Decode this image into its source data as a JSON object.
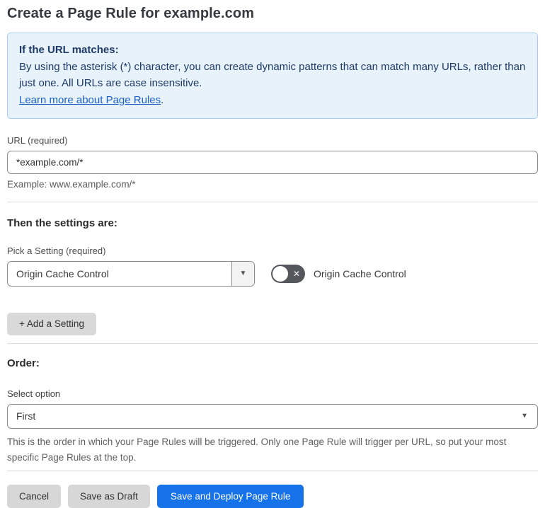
{
  "page": {
    "title": "Create a Page Rule for example.com"
  },
  "info_box": {
    "heading": "If the URL matches:",
    "body": "By using the asterisk (*) character, you can create dynamic patterns that can match many URLs, rather than just one. All URLs are case insensitive.",
    "link_label": "Learn more about Page Rules",
    "link_suffix": "."
  },
  "url_section": {
    "label": "URL (required)",
    "value": "*example.com/*",
    "helper": "Example: www.example.com/*"
  },
  "settings_section": {
    "heading": "Then the settings are:",
    "picker_label": "Pick a Setting (required)",
    "selected_setting": "Origin Cache Control",
    "toggle_label": "Origin Cache Control",
    "toggle_state": "off",
    "add_setting_label": "+ Add a Setting"
  },
  "order_section": {
    "heading": "Order:",
    "select_label": "Select option",
    "selected_option": "First",
    "helper": "This is the order in which your Page Rules will be triggered. Only one Page Rule will trigger per URL, so put your most specific Page Rules at the top."
  },
  "footer": {
    "cancel_label": "Cancel",
    "save_draft_label": "Save as Draft",
    "save_deploy_label": "Save and Deploy Page Rule"
  },
  "icons": {
    "dropdown_caret": "▼",
    "toggle_off_x": "✕"
  },
  "colors": {
    "accent_blue": "#1672e8",
    "info_bg": "#e8f2fb",
    "info_border": "#a9cdee",
    "info_text": "#1e3a68",
    "link_blue": "#1b5fc9",
    "toggle_off_bg": "#54575c",
    "button_gray": "#d7d7d7"
  }
}
